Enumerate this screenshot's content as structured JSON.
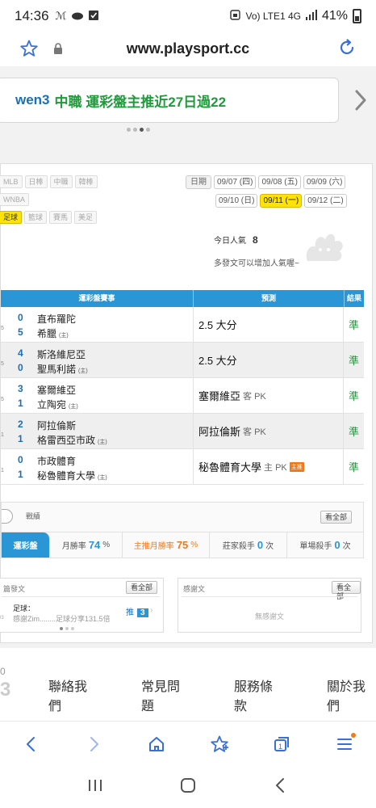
{
  "status_bar": {
    "time": "14:36",
    "network": "Vo) LTE1 4G",
    "battery": "41%"
  },
  "browser": {
    "url": "www.playsport.cc"
  },
  "banner": {
    "author": "wen3",
    "headline": "中職 運彩盤主推近27日過22"
  },
  "leagues": {
    "row1": [
      "MLB",
      "日棒",
      "中職",
      "韓棒"
    ],
    "row2": [
      "WNBA"
    ],
    "row3": [
      "足球",
      "籃球",
      "賽馬",
      "美足"
    ],
    "active": "足球"
  },
  "dates": {
    "label": "日期",
    "row1": [
      "09/07 (四)",
      "09/08 (五)",
      "09/09 (六)"
    ],
    "row2": [
      "09/10 (日)",
      "09/11 (一)",
      "09/12 (二)"
    ],
    "active": "09/11 (一)"
  },
  "popularity": {
    "label": "今日人氣",
    "value": "8",
    "note": "多發文可以增加人氣喔~"
  },
  "table": {
    "headers": [
      "運彩盤賽事",
      "預測",
      "結果"
    ],
    "rows": [
      {
        "edge1": "",
        "edge2": "5",
        "score1": "0",
        "team1": "直布羅陀",
        "score2": "5",
        "team2": "希臘",
        "home": "(主)",
        "pred": "2.5 大分",
        "pred_sub": "",
        "hot": "",
        "result": "準"
      },
      {
        "edge1": "",
        "edge2": "5",
        "score1": "4",
        "team1": "斯洛維尼亞",
        "score2": "0",
        "team2": "聖馬利諾",
        "home": "(主)",
        "pred": "2.5 大分",
        "pred_sub": "",
        "hot": "",
        "result": "準"
      },
      {
        "edge1": "",
        "edge2": "5",
        "score1": "3",
        "team1": "塞爾維亞",
        "score2": "1",
        "team2": "立陶宛",
        "home": "(主)",
        "pred": "塞爾維亞",
        "pred_sub": "客 PK",
        "hot": "",
        "result": "準"
      },
      {
        "edge1": "",
        "edge2": "1",
        "score1": "2",
        "team1": "阿拉倫斯",
        "score2": "1",
        "team2": "格雷西亞市政",
        "home": "(主)",
        "pred": "阿拉倫斯",
        "pred_sub": "客 PK",
        "hot": "",
        "result": "準"
      },
      {
        "edge1": "",
        "edge2": "1",
        "score1": "0",
        "team1": "市政體育",
        "score2": "1",
        "team2": "秘魯體育大學",
        "home": "(主)",
        "pred": "秘魯體育大學",
        "pred_sub": "主 PK",
        "hot": "主推",
        "result": "準"
      }
    ]
  },
  "record": {
    "title": "戰績",
    "see_all": "看全部",
    "tab": "運彩盤",
    "month_label": "月勝率",
    "month_value": "74",
    "main_label": "主推月勝率",
    "main_value": "75",
    "unit_pct": "%",
    "kill_label": "莊家殺手",
    "kill_value": "0",
    "single_label": "單場殺手",
    "single_value": "0",
    "unit_times": "次"
  },
  "posts_card": {
    "title": "篇發文",
    "see_all": "看全部",
    "post_title": "足球：",
    "post_snippet": "感謝Zim........足球分享131.5倍",
    "post_date": "03",
    "push_label": "推",
    "push_count": "3"
  },
  "thanks_card": {
    "title": "感謝文",
    "see_all": "看全部",
    "empty": "無感謝文"
  },
  "footer": {
    "ghost_top": "0",
    "ghost_big": "3",
    "links": [
      "聯絡我們",
      "常見問題",
      "服務條款",
      "關於我們"
    ]
  },
  "colors": {
    "accent": "#2a96d6",
    "highlight": "#ffe400",
    "green": "#1f9b3b",
    "orange": "#f07a1a"
  }
}
